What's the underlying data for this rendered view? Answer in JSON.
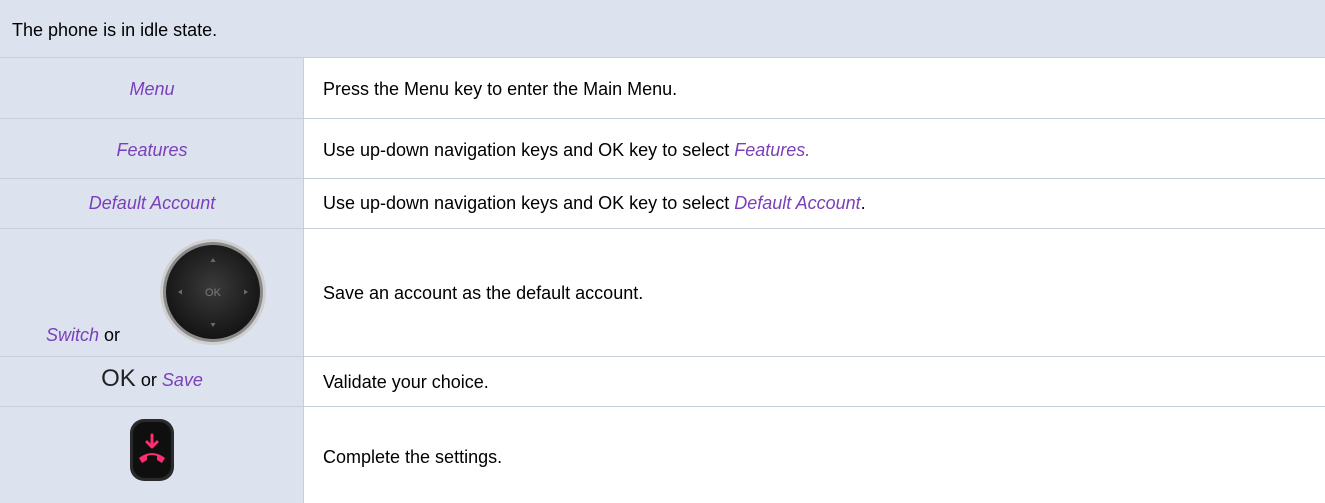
{
  "header": {
    "text": "The phone is in idle state."
  },
  "rows": [
    {
      "label": "Menu",
      "desc": "Press the Menu key to enter the Main Menu."
    },
    {
      "label": "Features",
      "desc_prefix": "Use up-down navigation keys and OK key to select ",
      "desc_em": "Features.",
      "desc_suffix": ""
    },
    {
      "label": "Default Account",
      "desc_prefix": "Use up-down navigation keys and OK key to select ",
      "desc_em": "Default Account",
      "desc_suffix": "."
    },
    {
      "label": "Switch",
      "connector": "or",
      "nav_ok": "OK",
      "desc": "Save an account as the default account."
    },
    {
      "label_ok": "OK",
      "connector": "or",
      "label": "Save",
      "desc": "Validate your choice."
    },
    {
      "icon": "end-call-key-icon",
      "desc": "Complete the settings."
    }
  ],
  "colors": {
    "accent": "#7b3fb8",
    "cell_bg": "#dce3ef",
    "key_red": "#ff2d6f"
  }
}
